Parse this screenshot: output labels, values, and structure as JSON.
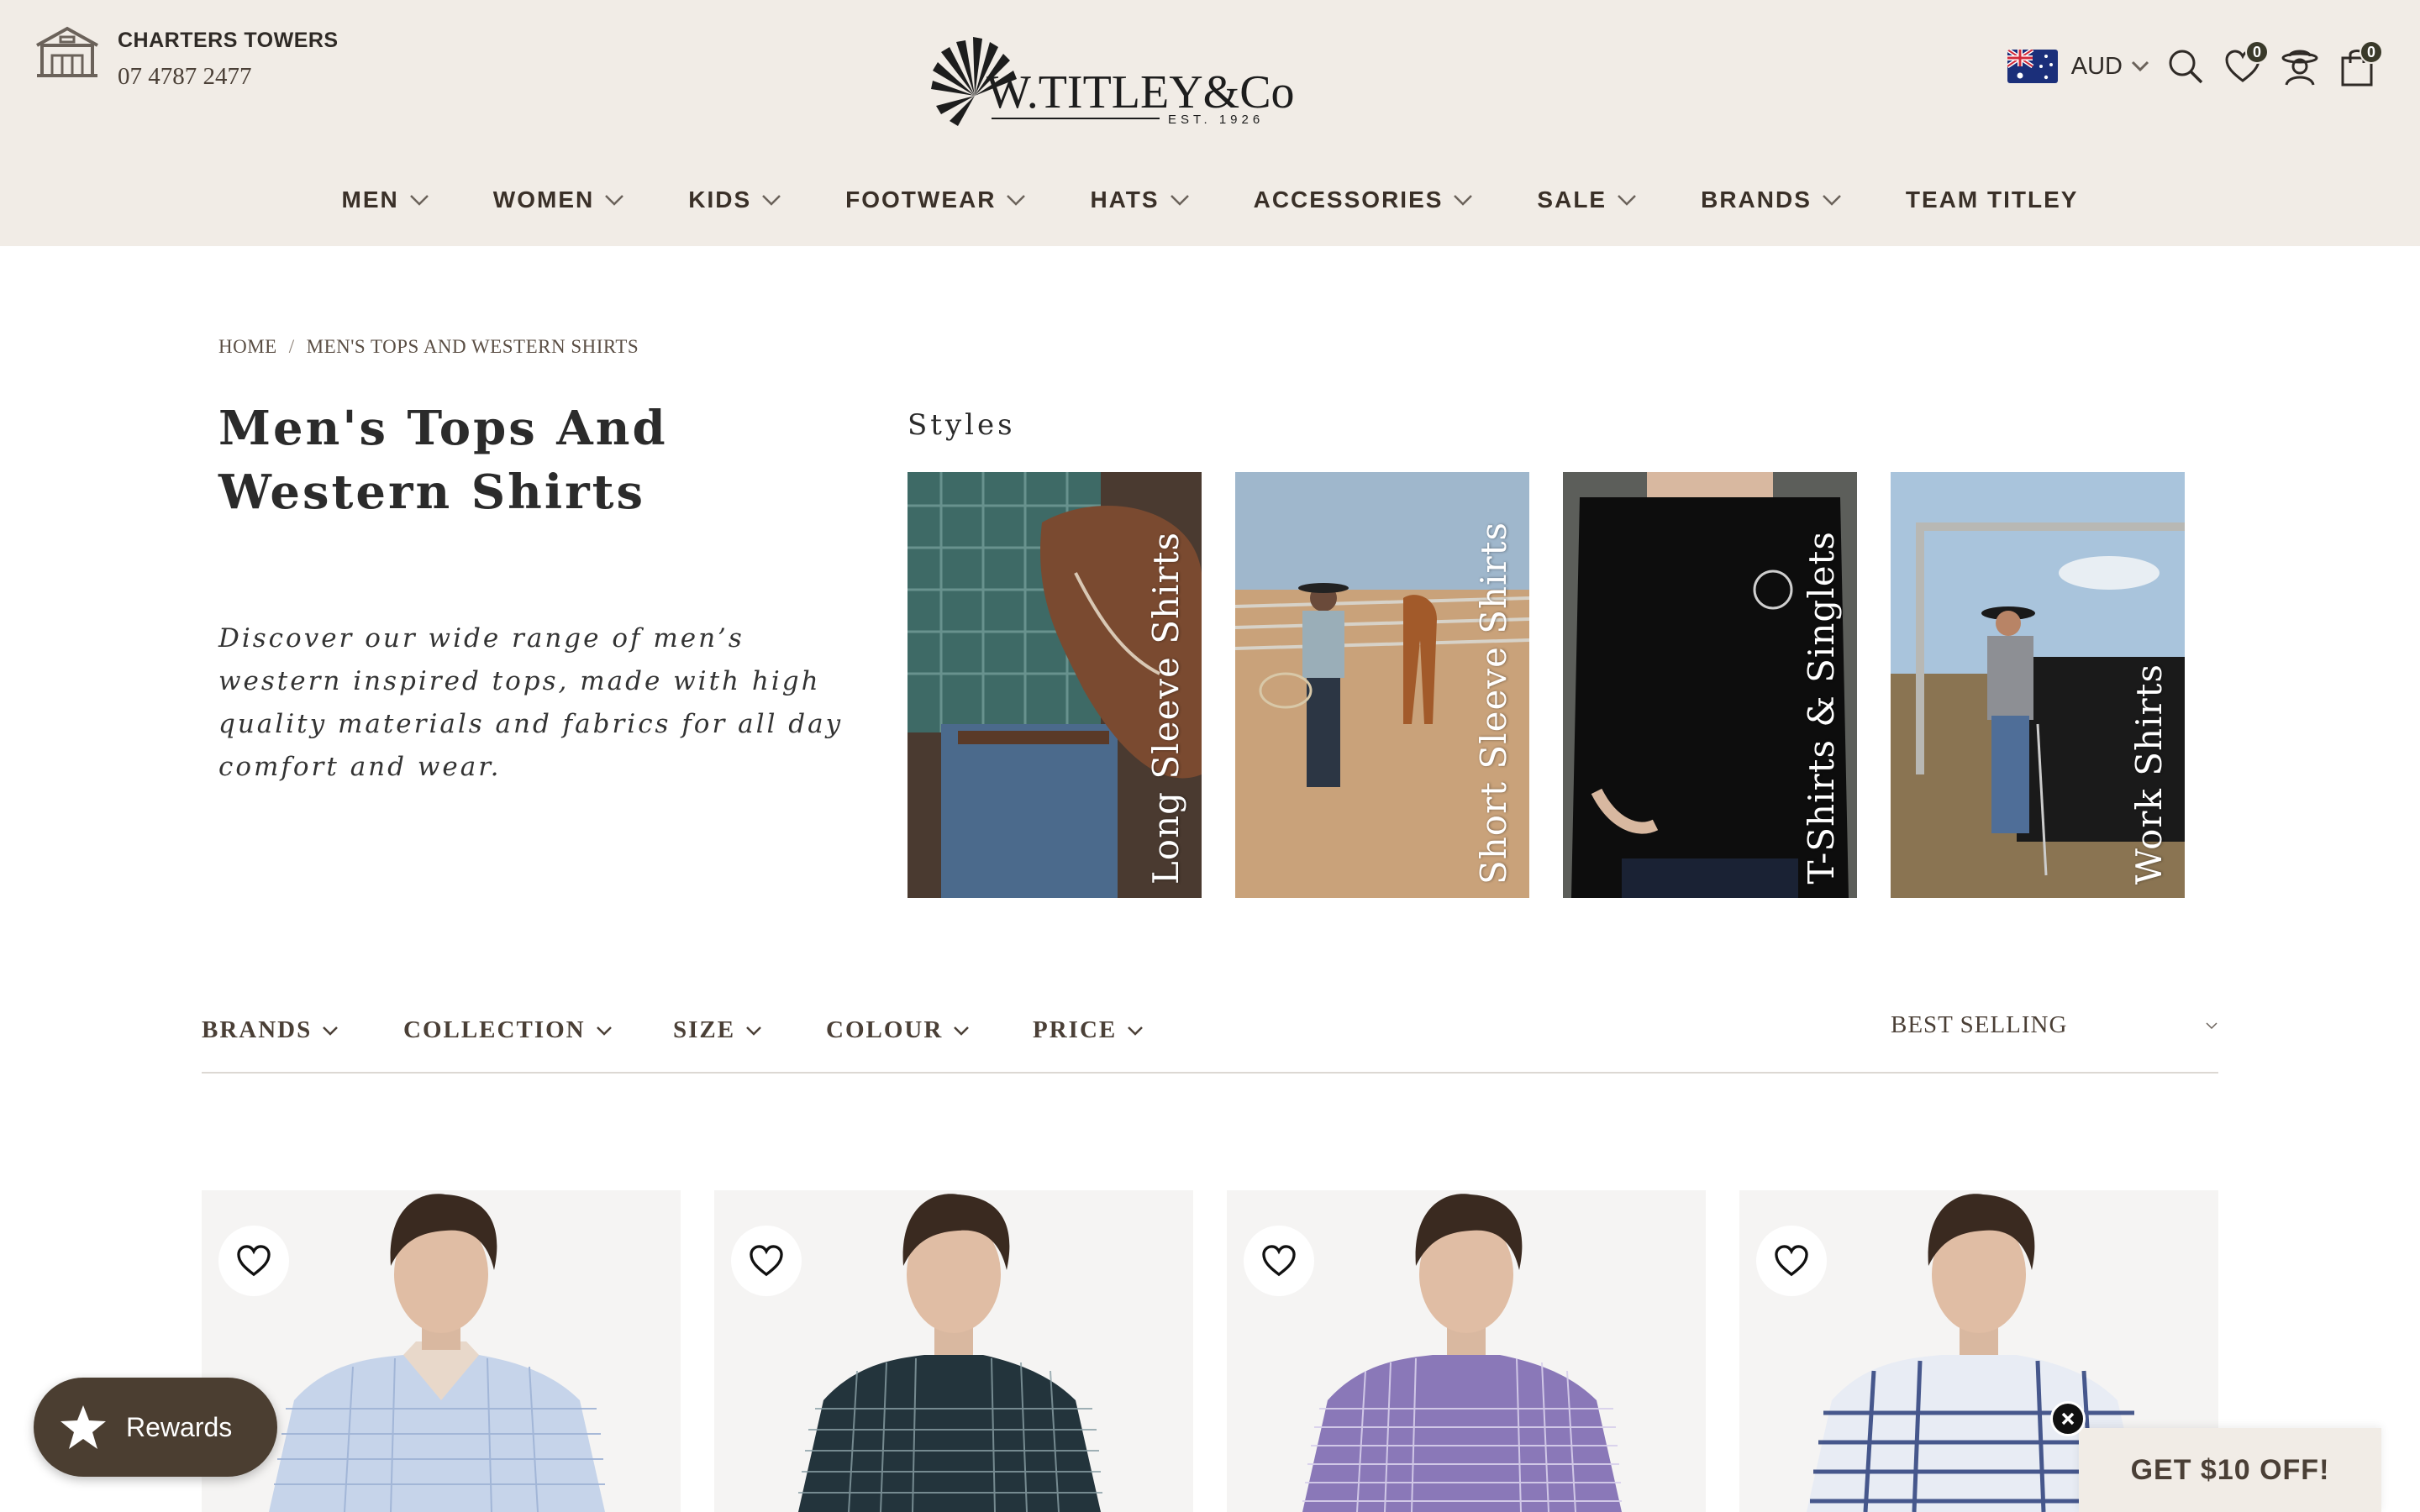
{
  "header": {
    "store_name": "CHARTERS TOWERS",
    "store_phone": "07 4787 2477",
    "logo_text": "W.TITLEY&Co",
    "logo_est": "EST. 1926",
    "currency": "AUD",
    "wishlist_count": "0",
    "cart_count": "0",
    "icons": [
      "store-icon",
      "australia-flag-icon",
      "chevron-down-icon",
      "search-icon",
      "heart-icon",
      "account-icon",
      "bag-icon"
    ]
  },
  "nav": {
    "items": [
      {
        "label": "MEN"
      },
      {
        "label": "WOMEN"
      },
      {
        "label": "KIDS"
      },
      {
        "label": "FOOTWEAR"
      },
      {
        "label": "HATS"
      },
      {
        "label": "ACCESSORIES"
      },
      {
        "label": "SALE"
      },
      {
        "label": "BRANDS"
      },
      {
        "label": "TEAM TITLEY"
      }
    ]
  },
  "breadcrumb": {
    "home": "HOME",
    "separator": "/",
    "current": "MEN'S TOPS AND WESTERN SHIRTS"
  },
  "page": {
    "title": "Men's Tops And Western Shirts",
    "description": "Discover our wide range of men’s western inspired tops, made with high quality materials and fabrics for all day comfort and wear."
  },
  "styles": {
    "heading": "Styles",
    "tiles": [
      {
        "label": "Long Sleeve Shirts"
      },
      {
        "label": "Short Sleeve Shirts"
      },
      {
        "label": "T-Shirts & Singlets"
      },
      {
        "label": "Work Shirts"
      }
    ]
  },
  "filters": {
    "items": [
      {
        "label": "BRANDS"
      },
      {
        "label": "COLLECTION"
      },
      {
        "label": "SIZE"
      },
      {
        "label": "COLOUR"
      },
      {
        "label": "PRICE"
      }
    ],
    "sort": "BEST SELLING"
  },
  "products": [
    {
      "shirt": "light-blue"
    },
    {
      "shirt": "navy-check"
    },
    {
      "shirt": "purple-check"
    },
    {
      "shirt": "blue-plaid"
    }
  ],
  "rewards": {
    "label": "Rewards"
  },
  "promo": {
    "label": "GET $10 OFF!"
  },
  "colors": {
    "header_bg": "#f1ece6",
    "brand_brown": "#4b3e31",
    "text_dark": "#2b2b2b"
  }
}
